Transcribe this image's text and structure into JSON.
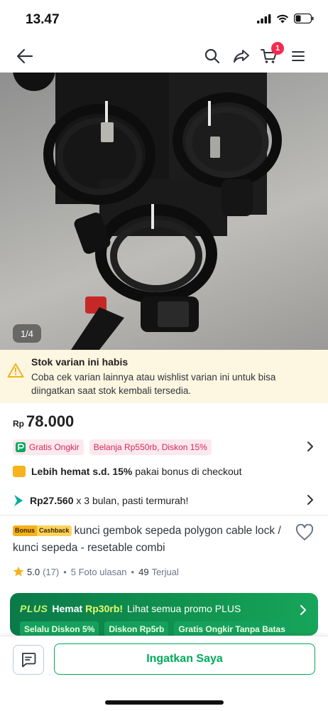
{
  "status_bar": {
    "time": "13.47"
  },
  "header": {
    "cart_count": "1"
  },
  "gallery": {
    "counter": "1/4"
  },
  "stock_notice": {
    "title": "Stok varian ini habis",
    "body": "Coba cek varian lainnya atau wishlist varian ini untuk bisa diingatkan saat stok kembali tersedia."
  },
  "price": {
    "prefix": "Rp",
    "value": "78.000"
  },
  "shipping": {
    "free_label": "Gratis Ongkir",
    "discount_label": "Belanja Rp550rb, Diskon 15%"
  },
  "savings": {
    "bold": "Lebih hemat s.d. 15%",
    "rest": " pakai bonus di checkout"
  },
  "installment": {
    "amount": "Rp27.560",
    "rest": " x 3 bulan, pasti termurah!"
  },
  "product": {
    "badge_left": "Bonus",
    "badge_right": "Cashback",
    "title": "kunci gembok sepeda polygon cable lock / kunci sepeda - resetable combi"
  },
  "rating": {
    "score": "5.0",
    "count": "(17)",
    "photos": "5 Foto ulasan",
    "sold_num": "49",
    "sold_label": "Terjual"
  },
  "plus_promo": {
    "logo": "PLUS",
    "hemat": "Hemat",
    "amount": "Rp30rb!",
    "rest": "Lihat semua promo PLUS",
    "chips": [
      "Selalu Diskon 5%",
      "Diskon Rp5rb",
      "Gratis Ongkir Tanpa Batas"
    ]
  },
  "bottom": {
    "remind_label": "Ingatkan Saya"
  },
  "colors": {
    "accent": "#00aa5b",
    "badge": "#f5294f",
    "warning_bg": "#fdf6e1",
    "plus_green": "#0b7a4a"
  }
}
